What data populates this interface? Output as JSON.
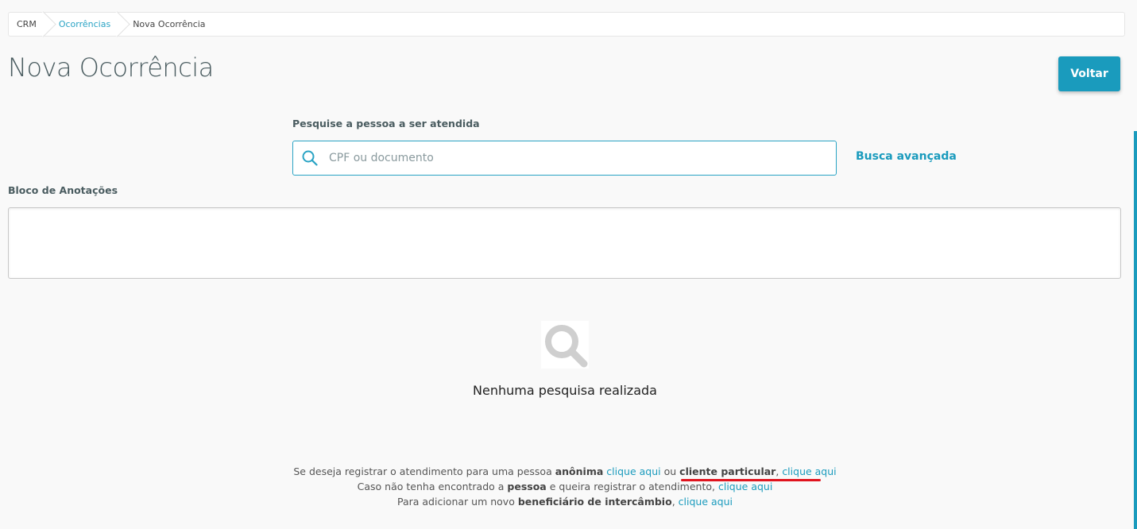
{
  "breadcrumb": {
    "items": [
      "CRM",
      "Ocorrências",
      "Nova Ocorrência"
    ]
  },
  "page": {
    "title": "Nova Ocorrência",
    "back_label": "Voltar"
  },
  "search": {
    "label": "Pesquise a pessoa a ser atendida",
    "placeholder": "CPF ou documento",
    "value": "",
    "advanced_label": "Busca avançada"
  },
  "notes": {
    "label": "Bloco de Anotações",
    "value": ""
  },
  "empty_state": {
    "icon": "search-icon",
    "text": "Nenhuma pesquisa realizada"
  },
  "info": {
    "line1": {
      "pre": "Se deseja registrar o atendimento para uma pessoa",
      "bold1": "anônima",
      "link1": "clique aqui",
      "mid": "ou",
      "bold2": "cliente particular",
      "comma": ",",
      "link2": "clique aqui"
    },
    "line2": {
      "pre": "Caso não tenha encontrado a",
      "bold": "pessoa",
      "post": "e queira registrar o atendimento,",
      "link": "clique aqui"
    },
    "line3": {
      "pre": "Para adicionar um novo",
      "bold": "beneficiário de intercâmbio",
      "post": ",",
      "link": "clique aqui"
    }
  },
  "colors": {
    "accent": "#1a9bbd",
    "annotation_red": "#e0141e"
  }
}
